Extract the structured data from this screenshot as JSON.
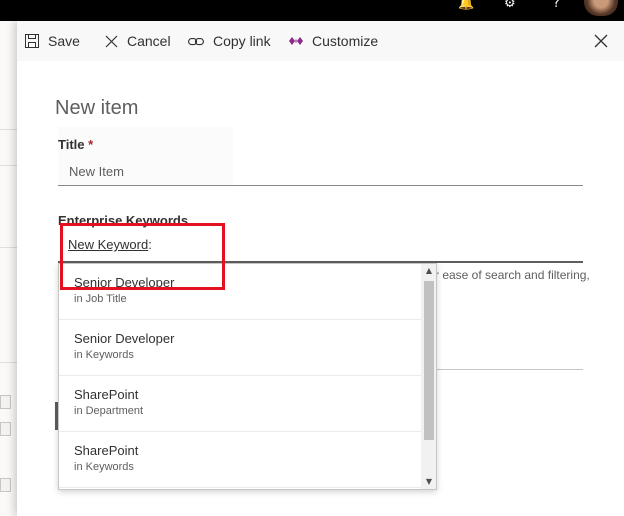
{
  "suitebar": {
    "icons": [
      "notification-icon",
      "gear-icon",
      "help-icon"
    ],
    "avatar_alt": ""
  },
  "commands": {
    "save": "Save",
    "cancel": "Cancel",
    "copy_link": "Copy link",
    "customize": "Customize"
  },
  "form": {
    "heading": "New item",
    "title_label": "Title",
    "required_mark": "*",
    "title_placeholder": "New Item",
    "keywords_label": "Enterprise Keywords",
    "keyword_link": "New Keyword",
    "keyword_colon": ":",
    "hint_fragment": "r ease of search and filtering,"
  },
  "suggestions": [
    {
      "term": "Senior Developer",
      "source": "in Job Title"
    },
    {
      "term": "Senior Developer",
      "source": "in Keywords"
    },
    {
      "term": "SharePoint",
      "source": "in Department"
    },
    {
      "term": "SharePoint",
      "source": "in Keywords"
    }
  ],
  "colors": {
    "highlight": "#e3101d",
    "customize_icon": "#8a2a88",
    "suite_bar": "#000000"
  }
}
